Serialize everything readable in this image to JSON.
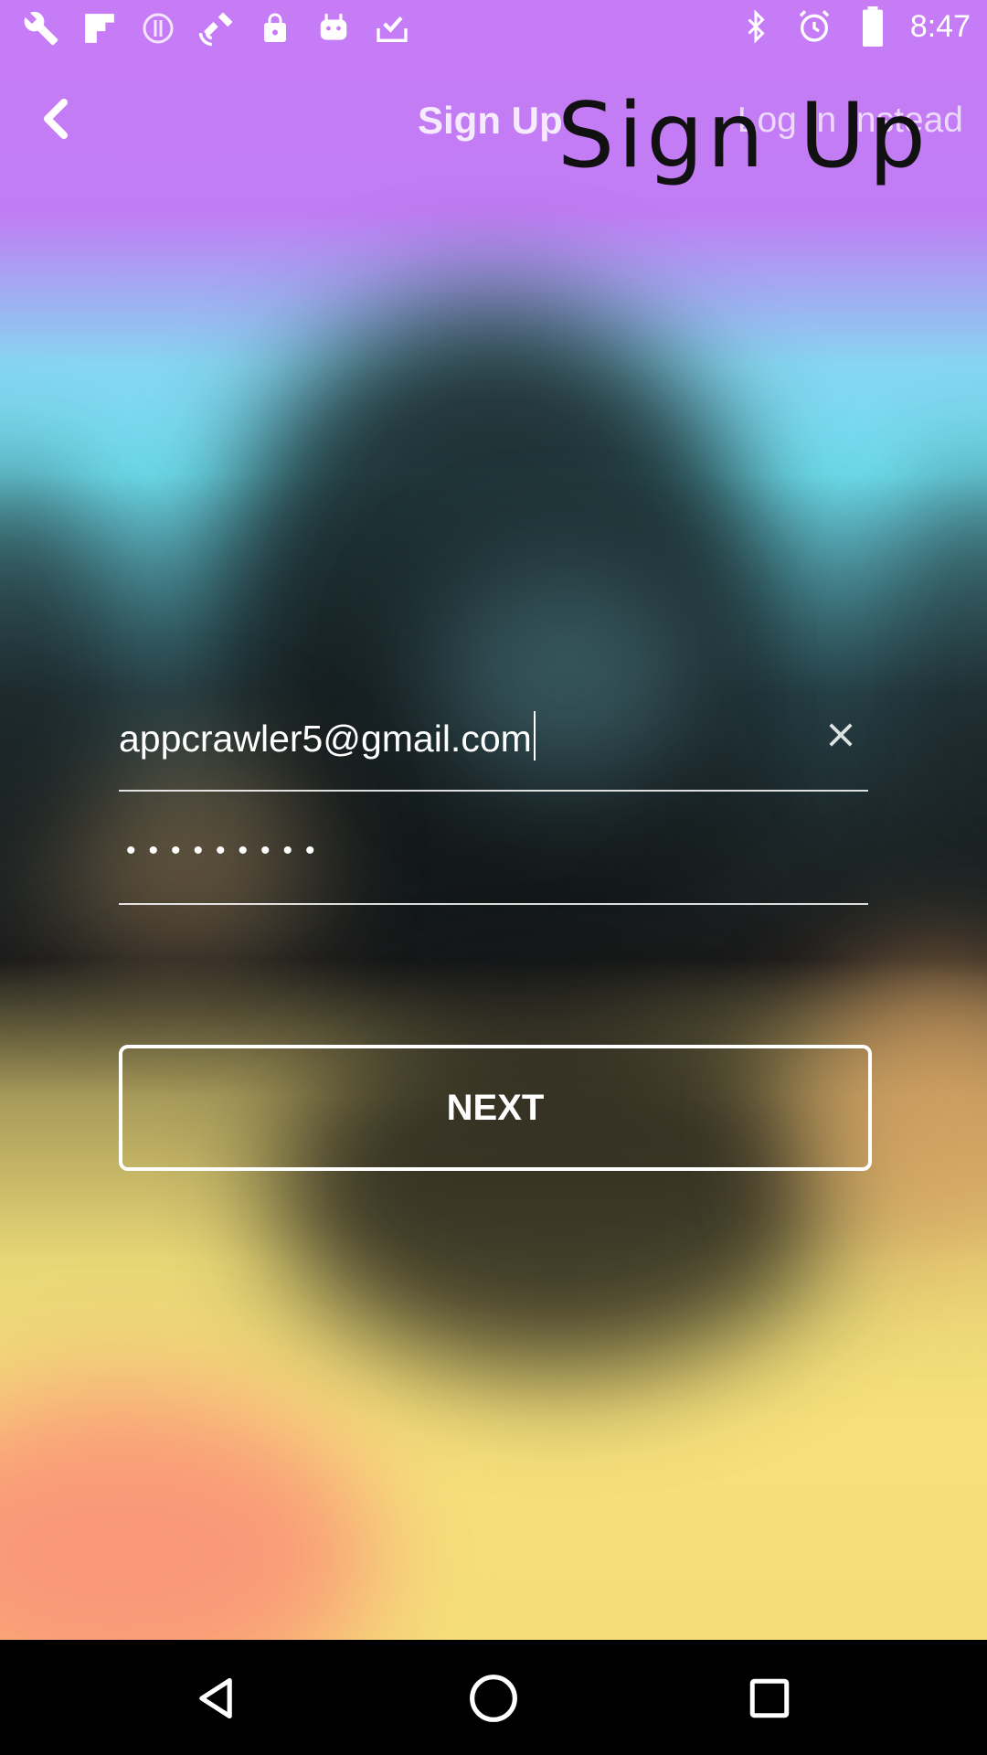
{
  "status_bar": {
    "time": "8:47",
    "left_icons": [
      "wrench-icon",
      "flipboard-icon",
      "info-icon",
      "fake-gps-icon",
      "lock-icon",
      "android-icon",
      "checklist-icon"
    ],
    "right_icons": [
      "bluetooth-icon",
      "alarm-icon",
      "battery-icon"
    ]
  },
  "app_bar": {
    "back_icon": "chevron-left-icon",
    "title": "Sign Up",
    "login_link": "Log In Instead"
  },
  "overlay": {
    "text": "Sign Up"
  },
  "form": {
    "email_value": "appcrawler5@gmail.com",
    "password_mask": "•••••••••",
    "clear_icon": "close-icon"
  },
  "next_button": {
    "label": "NEXT"
  },
  "nav_bar": {
    "icons": [
      "back-triangle-icon",
      "home-circle-icon",
      "recents-square-icon"
    ]
  },
  "colors": {
    "top_gradient": "#c77cf6",
    "mid_gradient": "#6fe0f0",
    "bottom_gradient": "#f5de7a",
    "button_border": "#ffffff"
  }
}
